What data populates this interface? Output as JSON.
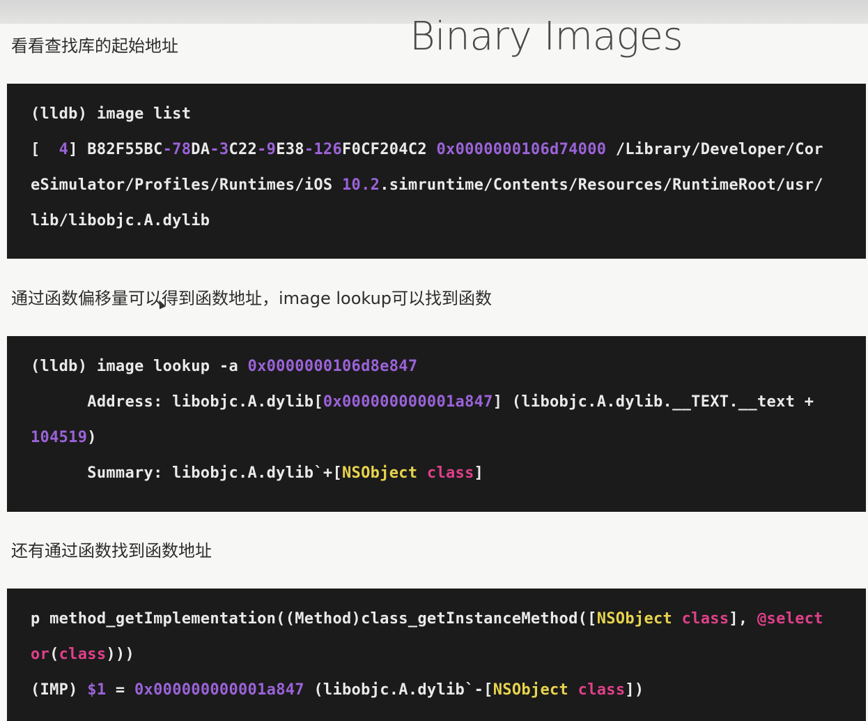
{
  "slide": {
    "title": "Binary Images",
    "captions": [
      "看看查找库的起始地址",
      "通过函数偏移量可以得到函数地址，image lookup可以找到函数",
      "还有通过函数找到函数地址"
    ]
  },
  "code_blocks": [
    {
      "lines": [
        [
          {
            "t": "(lldb) image list",
            "c": "w"
          }
        ],
        [
          {
            "t": "[  ",
            "c": "w"
          },
          {
            "t": "4",
            "c": "p"
          },
          {
            "t": "] B82F55BC",
            "c": "w"
          },
          {
            "t": "-78",
            "c": "p"
          },
          {
            "t": "DA",
            "c": "w"
          },
          {
            "t": "-3",
            "c": "p"
          },
          {
            "t": "C22",
            "c": "w"
          },
          {
            "t": "-9",
            "c": "p"
          },
          {
            "t": "E38",
            "c": "w"
          },
          {
            "t": "-126",
            "c": "p"
          },
          {
            "t": "F0CF204C2 ",
            "c": "w"
          },
          {
            "t": "0x0000000106d74000",
            "c": "p"
          },
          {
            "t": " /Library/Developer/Cor",
            "c": "w"
          }
        ],
        [
          {
            "t": "eSimulator/Profiles/Runtimes/iOS ",
            "c": "w"
          },
          {
            "t": "10.2",
            "c": "p"
          },
          {
            "t": ".simruntime/Contents/Resources/RuntimeRoot/usr/",
            "c": "w"
          }
        ],
        [
          {
            "t": "lib/libobjc.A.dylib",
            "c": "w"
          }
        ]
      ]
    },
    {
      "lines": [
        [
          {
            "t": "(lldb) image lookup -a ",
            "c": "w"
          },
          {
            "t": "0x0000000106d8e847",
            "c": "p"
          }
        ],
        [
          {
            "t": "      Address: libobjc.A.dylib[",
            "c": "w"
          },
          {
            "t": "0x000000000001a847",
            "c": "p"
          },
          {
            "t": "] (libobjc.A.dylib.__TEXT.__text +",
            "c": "w"
          }
        ],
        [
          {
            "t": "104519",
            "c": "p"
          },
          {
            "t": ")",
            "c": "w"
          }
        ],
        [
          {
            "t": "      Summary: libobjc.A.dylib`+[",
            "c": "w"
          },
          {
            "t": "NSObject",
            "c": "y"
          },
          {
            "t": " ",
            "c": "w"
          },
          {
            "t": "class",
            "c": "m"
          },
          {
            "t": "]",
            "c": "w"
          }
        ]
      ]
    },
    {
      "lines": [
        [
          {
            "t": "p method_getImplementation((Method)class_getInstanceMethod([",
            "c": "w"
          },
          {
            "t": "NSObject",
            "c": "y"
          },
          {
            "t": " ",
            "c": "w"
          },
          {
            "t": "class",
            "c": "m"
          },
          {
            "t": "], ",
            "c": "w"
          },
          {
            "t": "@select",
            "c": "m"
          }
        ],
        [
          {
            "t": "or",
            "c": "m"
          },
          {
            "t": "(",
            "c": "w"
          },
          {
            "t": "class",
            "c": "m"
          },
          {
            "t": ")))",
            "c": "w"
          }
        ],
        [
          {
            "t": "(IMP) ",
            "c": "w"
          },
          {
            "t": "$1",
            "c": "p"
          },
          {
            "t": " = ",
            "c": "w"
          },
          {
            "t": "0x000000000001a847",
            "c": "p"
          },
          {
            "t": " (libobjc.A.dylib`-[",
            "c": "w"
          },
          {
            "t": "NSObject",
            "c": "y"
          },
          {
            "t": " ",
            "c": "w"
          },
          {
            "t": "class",
            "c": "m"
          },
          {
            "t": "])",
            "c": "w"
          }
        ]
      ]
    }
  ]
}
